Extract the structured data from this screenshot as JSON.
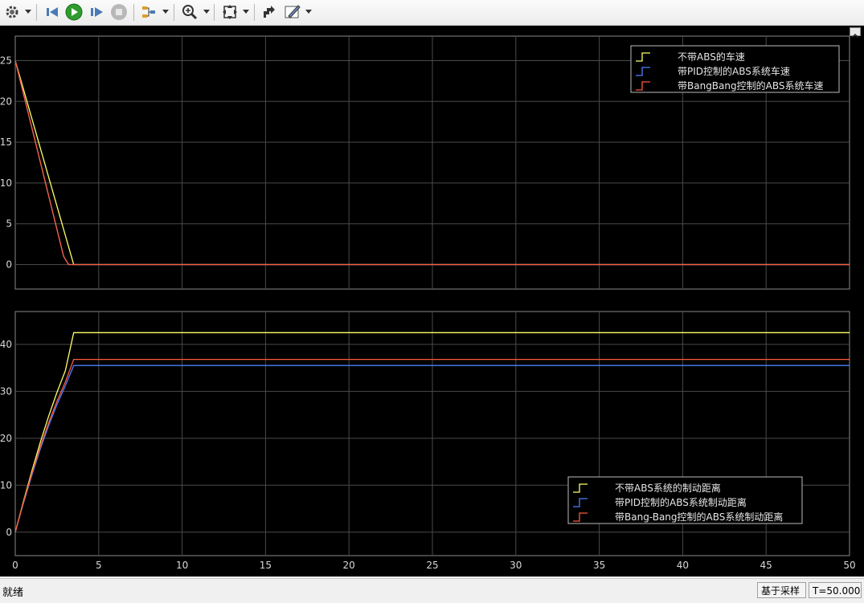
{
  "toolbar": {
    "icons": [
      "gear-icon",
      "chevron-down-icon",
      "step-back-icon",
      "run-icon",
      "step-forward-icon",
      "stop-icon",
      "signal-select-icon",
      "chevron-down-icon",
      "zoom-in-icon",
      "chevron-down-icon",
      "autoscale-icon",
      "chevron-down-icon",
      "highlight-icon",
      "measure-icon",
      "chevron-down-icon"
    ]
  },
  "status": {
    "text": "就绪",
    "sample": "基于采样",
    "time": "T=50.000"
  },
  "chart_data": [
    {
      "type": "line",
      "title": "",
      "xlabel": "",
      "ylabel": "",
      "xlim": [
        0,
        50
      ],
      "ylim": [
        -3,
        28
      ],
      "xticks": [
        0,
        5,
        10,
        15,
        20,
        25,
        30,
        35,
        40,
        45,
        50
      ],
      "yticks": [
        0,
        5,
        10,
        15,
        20,
        25
      ],
      "show_x_ticklabels": false,
      "grid": true,
      "legend_position": "top-right",
      "series": [
        {
          "name": "不带ABS的车速",
          "color": "#ffff66",
          "x": [
            0,
            3.5,
            50
          ],
          "y": [
            25,
            0,
            0
          ]
        },
        {
          "name": "带PID控制的ABS系统车速",
          "color": "#4d7fff",
          "x": [
            0,
            2.9,
            3.2,
            50
          ],
          "y": [
            25,
            1,
            0,
            0
          ]
        },
        {
          "name": "带BangBang控制的ABS系统车速",
          "color": "#ff5a3c",
          "x": [
            0,
            2.9,
            3.2,
            50
          ],
          "y": [
            25,
            1,
            0,
            0
          ]
        }
      ]
    },
    {
      "type": "line",
      "title": "",
      "xlabel": "",
      "ylabel": "",
      "xlim": [
        0,
        50
      ],
      "ylim": [
        -5,
        47
      ],
      "xticks": [
        0,
        5,
        10,
        15,
        20,
        25,
        30,
        35,
        40,
        45,
        50
      ],
      "yticks": [
        0,
        10,
        20,
        30,
        40
      ],
      "show_x_ticklabels": true,
      "grid": true,
      "legend_position": "bottom-right",
      "series": [
        {
          "name": "不带ABS系统的制动距离",
          "color": "#ffff66",
          "x": [
            0,
            0.5,
            1,
            1.5,
            2,
            2.5,
            3,
            3.5,
            50
          ],
          "y": [
            0,
            6.7,
            13.1,
            19.1,
            24.7,
            29.8,
            34.4,
            42.5,
            42.5
          ]
        },
        {
          "name": "带PID控制的ABS系统制动距离",
          "color": "#4d7fff",
          "x": [
            0,
            0.5,
            1,
            1.5,
            2,
            2.5,
            3,
            3.5,
            50
          ],
          "y": [
            0,
            6.3,
            12.2,
            17.7,
            22.7,
            27.2,
            31.2,
            35.5,
            35.5
          ]
        },
        {
          "name": "带Bang-Bang控制的ABS系统制动距离",
          "color": "#ff5a3c",
          "x": [
            0,
            0.5,
            1,
            1.5,
            2,
            2.5,
            3,
            3.5,
            50
          ],
          "y": [
            0,
            6.5,
            12.6,
            18.2,
            23.3,
            27.9,
            32,
            36.8,
            36.8
          ]
        }
      ]
    }
  ]
}
